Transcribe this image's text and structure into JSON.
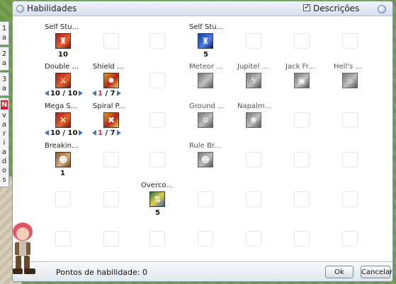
{
  "window": {
    "title": "Habilidades",
    "description_toggle_label": "Descrições",
    "description_checked": true
  },
  "side_tabs": [
    {
      "text": "1a"
    },
    {
      "text": "2a"
    },
    {
      "text": "3a"
    },
    {
      "badge": "N",
      "text": "variados"
    }
  ],
  "skills": {
    "self_stu_1": {
      "name": "Self Stu...",
      "level": "10",
      "icon": "red-fist-icon"
    },
    "self_stu_2": {
      "name": "Self Stu...",
      "level": "5",
      "icon": "blue-fist-icon"
    },
    "double": {
      "name": "Double ...",
      "cur": "10",
      "max": "10",
      "icon": "double-attack-icon"
    },
    "shield": {
      "name": "Shield ...",
      "cur": "1",
      "max": "7",
      "icon": "shield-icon"
    },
    "meteor": {
      "name": "Meteor ...",
      "icon": "meteor-icon"
    },
    "jupitel": {
      "name": "Jupitel ...",
      "icon": "lightning-icon"
    },
    "jack": {
      "name": "Jack Fr...",
      "icon": "frost-icon"
    },
    "hells": {
      "name": "Hell's ...",
      "icon": "flame-icon"
    },
    "mega": {
      "name": "Mega S...",
      "cur": "10",
      "max": "10",
      "icon": "sword-icon"
    },
    "spiral": {
      "name": "Spiral P...",
      "cur": "1",
      "max": "7",
      "icon": "spiral-icon"
    },
    "ground": {
      "name": "Ground ...",
      "icon": "star-seal-icon"
    },
    "napalm": {
      "name": "Napalm...",
      "icon": "burst-icon"
    },
    "breakin": {
      "name": "Breakin...",
      "level": "1",
      "icon": "break-icon"
    },
    "rule": {
      "name": "Rule Br...",
      "icon": "rule-break-icon"
    },
    "overco": {
      "name": "Overco...",
      "level": "5",
      "icon": "overcome-icon"
    }
  },
  "footer": {
    "points_label": "Pontos de habilidade: 0",
    "ok_label": "Ok",
    "cancel_label": "Cancelar"
  },
  "colors": {
    "accent_arrow": "#4f6fb8",
    "level_red": "#d0245c"
  }
}
